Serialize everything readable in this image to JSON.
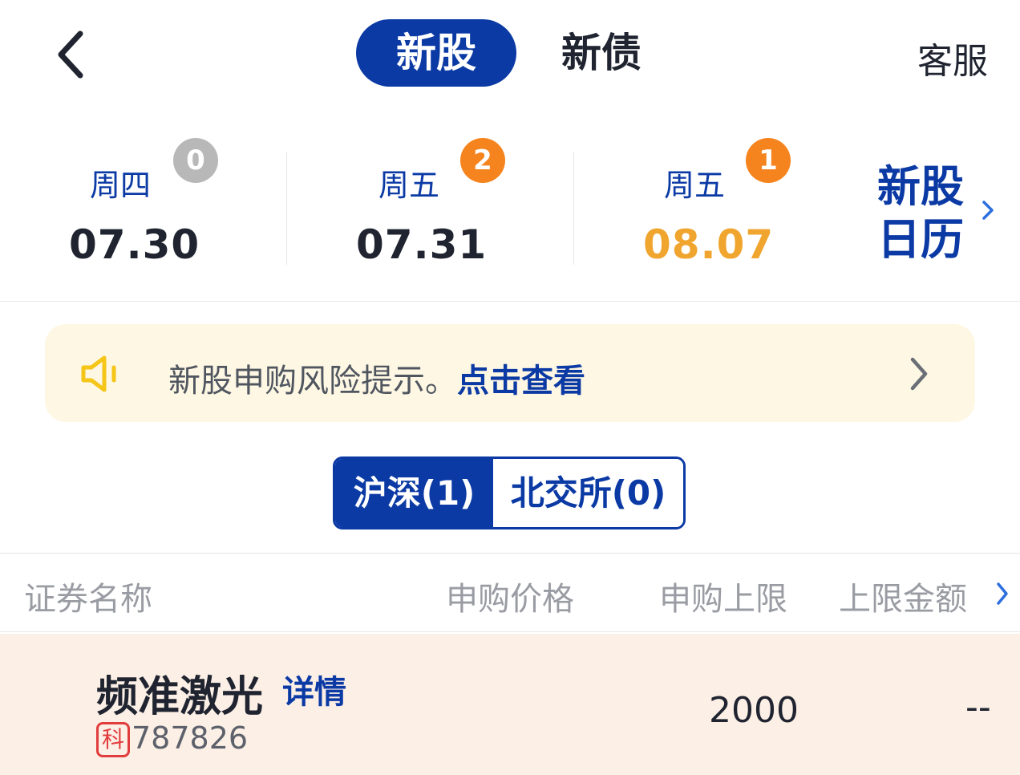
{
  "header": {
    "tabs": [
      {
        "label": "新股",
        "active": true
      },
      {
        "label": "新债",
        "active": false
      }
    ],
    "customer_service": "客服"
  },
  "days": [
    {
      "weekday": "周四",
      "date": "07.30",
      "count": "0",
      "badge_color": "#b8b8b8",
      "date_color": "#1f2430"
    },
    {
      "weekday": "周五",
      "date": "07.31",
      "count": "2",
      "badge_color": "#f5841f",
      "date_color": "#1f2430"
    },
    {
      "weekday": "周五",
      "date": "08.07",
      "count": "1",
      "badge_color": "#f5841f",
      "date_color": "#f0a52e"
    }
  ],
  "calendar_link": {
    "label": "新股日历"
  },
  "risk_notice": {
    "text": "新股申购风险提示。",
    "link": "点击查看"
  },
  "market_tabs": [
    {
      "label": "沪深(1)",
      "active": true
    },
    {
      "label": "北交所(0)",
      "active": false
    }
  ],
  "table": {
    "columns": [
      "证券名称",
      "申购价格",
      "申购上限",
      "上限金额"
    ],
    "rows": [
      {
        "name": "频准激光",
        "detail": "详情",
        "market_tag": "科",
        "code": "787826",
        "price": "",
        "limit": "2000",
        "amount": "--"
      }
    ]
  },
  "colors": {
    "brand_blue": "#0b3aa5",
    "badge_orange": "#f5841f",
    "highlight_date": "#f0a52e",
    "banner_bg": "#fdf7e3",
    "row_bg": "#fcefe6"
  }
}
